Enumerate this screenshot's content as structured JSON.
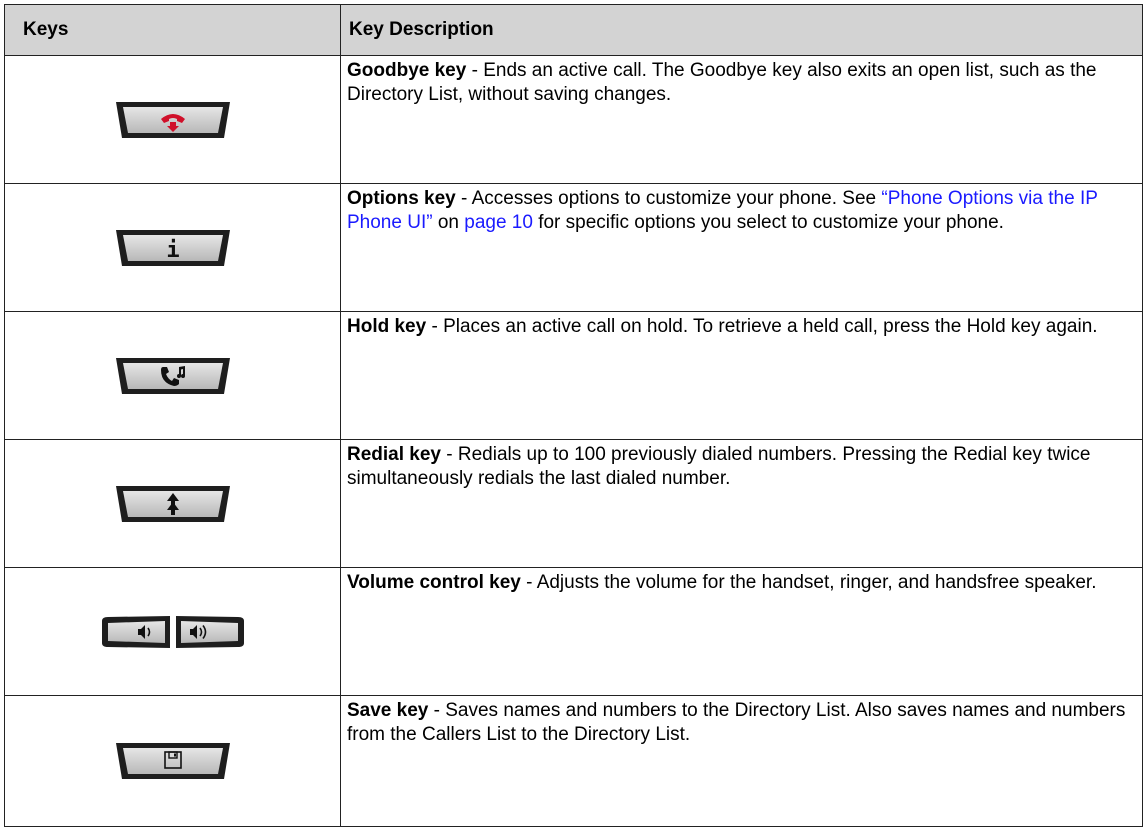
{
  "table": {
    "headers": {
      "keys": "Keys",
      "description": "Key Description"
    },
    "rows": [
      {
        "icon": "goodbye-key-icon",
        "title": "Goodbye key",
        "text": " - Ends an active call. The Goodbye key also exits an open list, such as the Directory List, without saving changes."
      },
      {
        "icon": "options-key-icon",
        "title": "Options key",
        "text_before": " - Accesses options to customize your phone. See ",
        "link1": "“Phone Options via the IP Phone UI”",
        "text_mid": " on ",
        "link2": "page 10",
        "text_after": " for specific options you select to customize your phone."
      },
      {
        "icon": "hold-key-icon",
        "title": "Hold key",
        "text": " - Places an active call on hold. To retrieve a held call, press the Hold key again."
      },
      {
        "icon": "redial-key-icon",
        "title": "Redial key",
        "text": " - Redials up to 100 previously dialed numbers. Pressing the Redial key twice simultaneously redials the last dialed number."
      },
      {
        "icon": "volume-key-icon",
        "title": "Volume control key",
        "text": " - Adjusts the volume for the handset, ringer, and handsfree speaker."
      },
      {
        "icon": "save-key-icon",
        "title": "Save key",
        "text": " - Saves names and numbers to the Directory List. Also saves names and numbers from the Callers List to the Directory List."
      }
    ]
  },
  "colors": {
    "header_bg": "#d3d3d3",
    "link": "#1a1aff",
    "key_face": "#c4c4c4",
    "key_rim": "#1e1e1e",
    "goodbye_red": "#d0102a"
  }
}
